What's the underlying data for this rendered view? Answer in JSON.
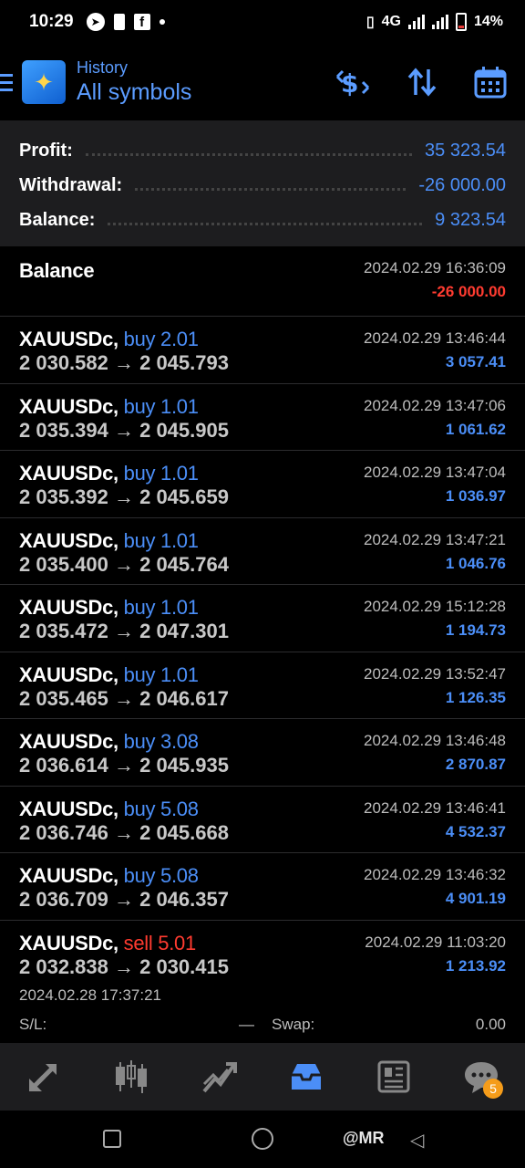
{
  "status_bar": {
    "time": "10:29",
    "network": "4G",
    "battery": "14%"
  },
  "header": {
    "subtitle": "History",
    "title": "All symbols"
  },
  "summary": [
    {
      "label": "Profit:",
      "value": "35 323.54"
    },
    {
      "label": "Withdrawal:",
      "value": "-26 000.00"
    },
    {
      "label": "Balance:",
      "value": "9 323.54"
    }
  ],
  "balance_row": {
    "label": "Balance",
    "datetime": "2024.02.29 16:36:09",
    "amount": "-26 000.00"
  },
  "trades": [
    {
      "symbol": "XAUUSDc,",
      "side": "buy 2.01",
      "prices": "2 030.582 → 2 045.793",
      "datetime": "2024.02.29 13:46:44",
      "profit": "3 057.41"
    },
    {
      "symbol": "XAUUSDc,",
      "side": "buy 1.01",
      "prices": "2 035.394 → 2 045.905",
      "datetime": "2024.02.29 13:47:06",
      "profit": "1 061.62"
    },
    {
      "symbol": "XAUUSDc,",
      "side": "buy 1.01",
      "prices": "2 035.392 → 2 045.659",
      "datetime": "2024.02.29 13:47:04",
      "profit": "1 036.97"
    },
    {
      "symbol": "XAUUSDc,",
      "side": "buy 1.01",
      "prices": "2 035.400 → 2 045.764",
      "datetime": "2024.02.29 13:47:21",
      "profit": "1 046.76"
    },
    {
      "symbol": "XAUUSDc,",
      "side": "buy 1.01",
      "prices": "2 035.472 → 2 047.301",
      "datetime": "2024.02.29 15:12:28",
      "profit": "1 194.73"
    },
    {
      "symbol": "XAUUSDc,",
      "side": "buy 1.01",
      "prices": "2 035.465 → 2 046.617",
      "datetime": "2024.02.29 13:52:47",
      "profit": "1 126.35"
    },
    {
      "symbol": "XAUUSDc,",
      "side": "buy 3.08",
      "prices": "2 036.614 → 2 045.935",
      "datetime": "2024.02.29 13:46:48",
      "profit": "2 870.87"
    },
    {
      "symbol": "XAUUSDc,",
      "side": "buy 5.08",
      "prices": "2 036.746 → 2 045.668",
      "datetime": "2024.02.29 13:46:41",
      "profit": "4 532.37"
    },
    {
      "symbol": "XAUUSDc,",
      "side": "buy 5.08",
      "prices": "2 036.709 → 2 046.357",
      "datetime": "2024.02.29 13:46:32",
      "profit": "4 901.19"
    }
  ],
  "expanded_trade": {
    "symbol": "XAUUSDc,",
    "side": "sell 5.01",
    "prices": "2 032.838 → 2 030.415",
    "datetime": "2024.02.29 11:03:20",
    "profit": "1 213.92",
    "open_time": "2024.02.28 17:37:21",
    "sl_label": "S/L:",
    "sl_value": "—",
    "swap_label": "Swap:",
    "swap_value": "0.00"
  },
  "bottom_nav": {
    "chat_badge": "5"
  },
  "watermark": "@MR"
}
